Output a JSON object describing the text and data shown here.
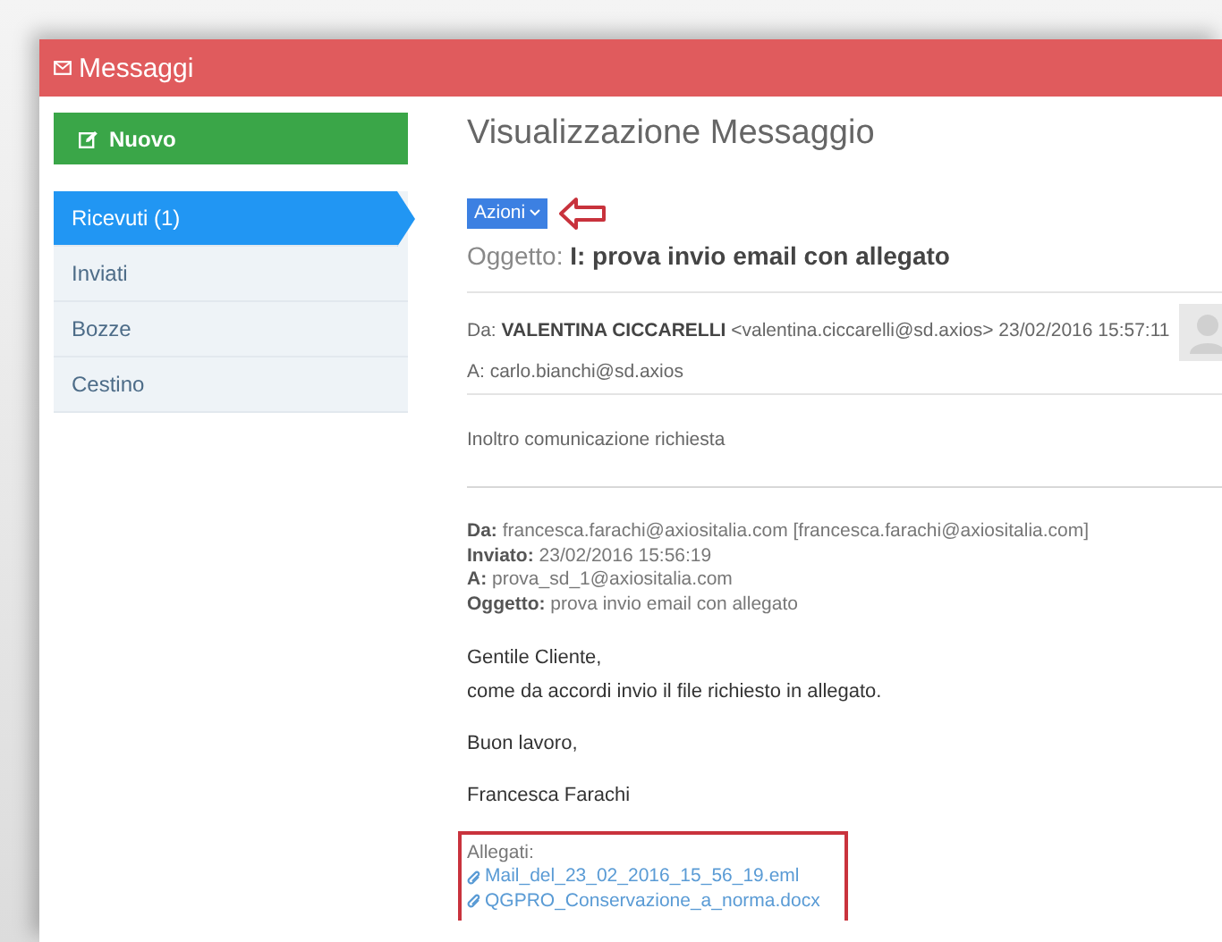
{
  "header": {
    "title": "Messaggi"
  },
  "sidebar": {
    "new_button": "Nuovo",
    "items": [
      {
        "label": "Ricevuti (1)",
        "selected": true
      },
      {
        "label": "Inviati",
        "selected": false
      },
      {
        "label": "Bozze",
        "selected": false
      },
      {
        "label": "Cestino",
        "selected": false
      }
    ]
  },
  "message": {
    "heading": "Visualizzazione Messaggio",
    "actions_button": "Azioni",
    "subject": "Oggetto: **I: prova invio email con allegato**",
    "from": "Da: **VALENTINA CICCARELLI** <valentina.ciccarelli@sd.axios> 23/02/2016 15:57:11",
    "to": "A: carlo.bianchi@sd.axios",
    "intro": "Inoltro comunicazione richiesta",
    "forwarded_header": [
      "**Da:** francesca.farachi@axiositalia.com [francesca.farachi@axiositalia.com]",
      "**Inviato:** 23/02/2016 15:56:19",
      "**A:** prova_sd_1@axiositalia.com",
      "**Oggetto:** prova invio email con allegato"
    ],
    "body": [
      [
        "Gentile Cliente,",
        "come da accordi invio il file richiesto in allegato."
      ],
      [
        "Buon lavoro,"
      ],
      [
        "Francesca Farachi"
      ]
    ],
    "attachments": {
      "label": "Allegati:",
      "files": [
        "Mail_del_23_02_2016_15_56_19.eml",
        "QGPRO_Conservazione_a_norma.docx"
      ]
    }
  }
}
